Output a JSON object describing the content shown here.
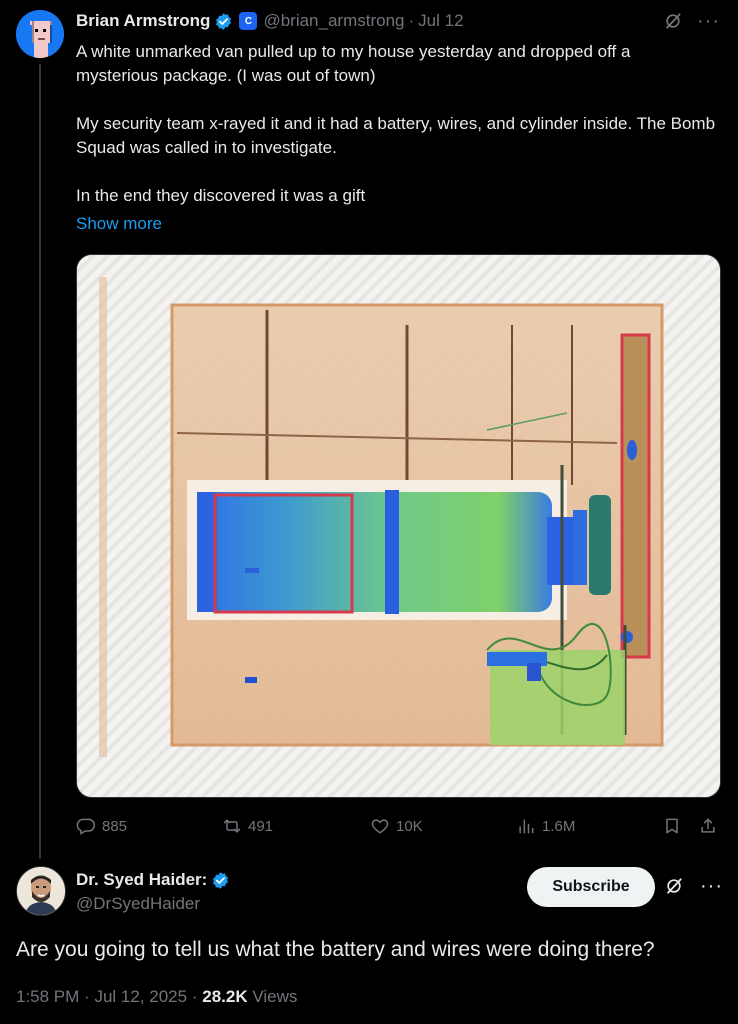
{
  "tweet": {
    "author_name": "Brian Armstrong",
    "author_handle": "@brian_armstrong",
    "separator": "·",
    "date": "Jul 12",
    "badge_letter": "C",
    "paragraphs": [
      "A white unmarked van pulled up to my house yesterday and dropped off a mysterious package. (I was out of town)",
      "My security team x-rayed it and it had a battery, wires, and cylinder inside. The Bomb Squad was called in to investigate.",
      "In the end they discovered it was a gift"
    ],
    "show_more": "Show more",
    "image_icon": "xray-image",
    "stats": {
      "replies": "885",
      "reposts": "491",
      "likes": "10K",
      "views": "1.6M"
    }
  },
  "reply": {
    "author_name": "Dr. Syed Haider:",
    "author_handle": "@DrSyedHaider",
    "subscribe_label": "Subscribe",
    "text": "Are you going to tell us what the battery and wires were doing there?",
    "time": "1:58 PM",
    "dot": "·",
    "date": "Jul 12, 2025",
    "views_count": "28.2K",
    "views_label": "Views"
  },
  "colors": {
    "background": "#000000",
    "accent": "#1d9bf0",
    "muted": "#71767b",
    "text": "#e7e9ea"
  }
}
